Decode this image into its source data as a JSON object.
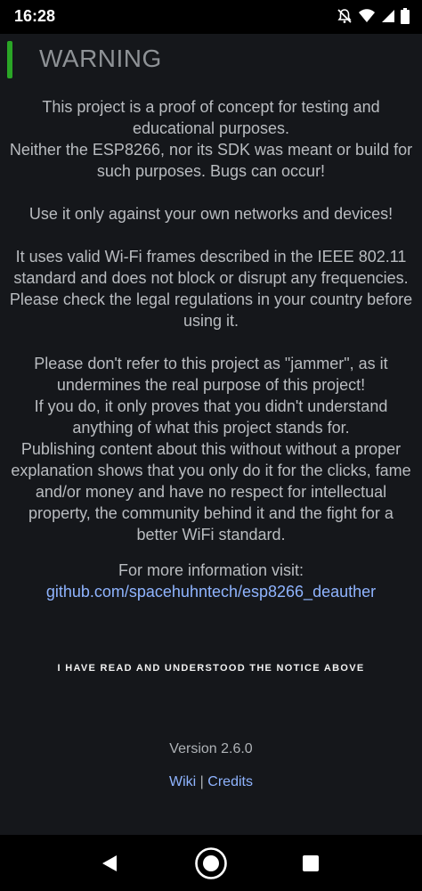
{
  "status": {
    "time": "16:28",
    "icons": [
      "notifications-off-icon",
      "wifi-icon",
      "signal-icon",
      "battery-icon"
    ]
  },
  "header": {
    "title": "WARNING"
  },
  "notice": {
    "paragraphs": [
      "This project is a proof of concept for testing and educational purposes.\nNeither the ESP8266, nor its SDK was meant or build for such purposes. Bugs can occur!",
      "Use it only against your own networks and devices!",
      "It uses valid Wi-Fi frames described in the IEEE 802.11 standard and does not block or disrupt any frequencies.\nPlease check the legal regulations in your country before using it.",
      "Please don't refer to this project as \"jammer\", as it undermines the real purpose of this project!\nIf you do, it only proves that you didn't understand anything of what this project stands for.\nPublishing content about this without without a proper explanation shows that you only do it for the clicks, fame and/or money and have no respect for intellectual property, the community behind it and the fight for a better WiFi standard."
    ],
    "info_label": "For more information visit:",
    "info_link": "github.com/spacehuhntech/esp8266_deauther"
  },
  "ack_button": "I HAVE READ AND UNDERSTOOD THE NOTICE ABOVE",
  "footer": {
    "version": "Version 2.6.0",
    "wiki": "Wiki",
    "separator": " | ",
    "credits": "Credits"
  },
  "colors": {
    "background": "#15171b",
    "accent": "#2aa526",
    "link": "#8fb4ff"
  }
}
